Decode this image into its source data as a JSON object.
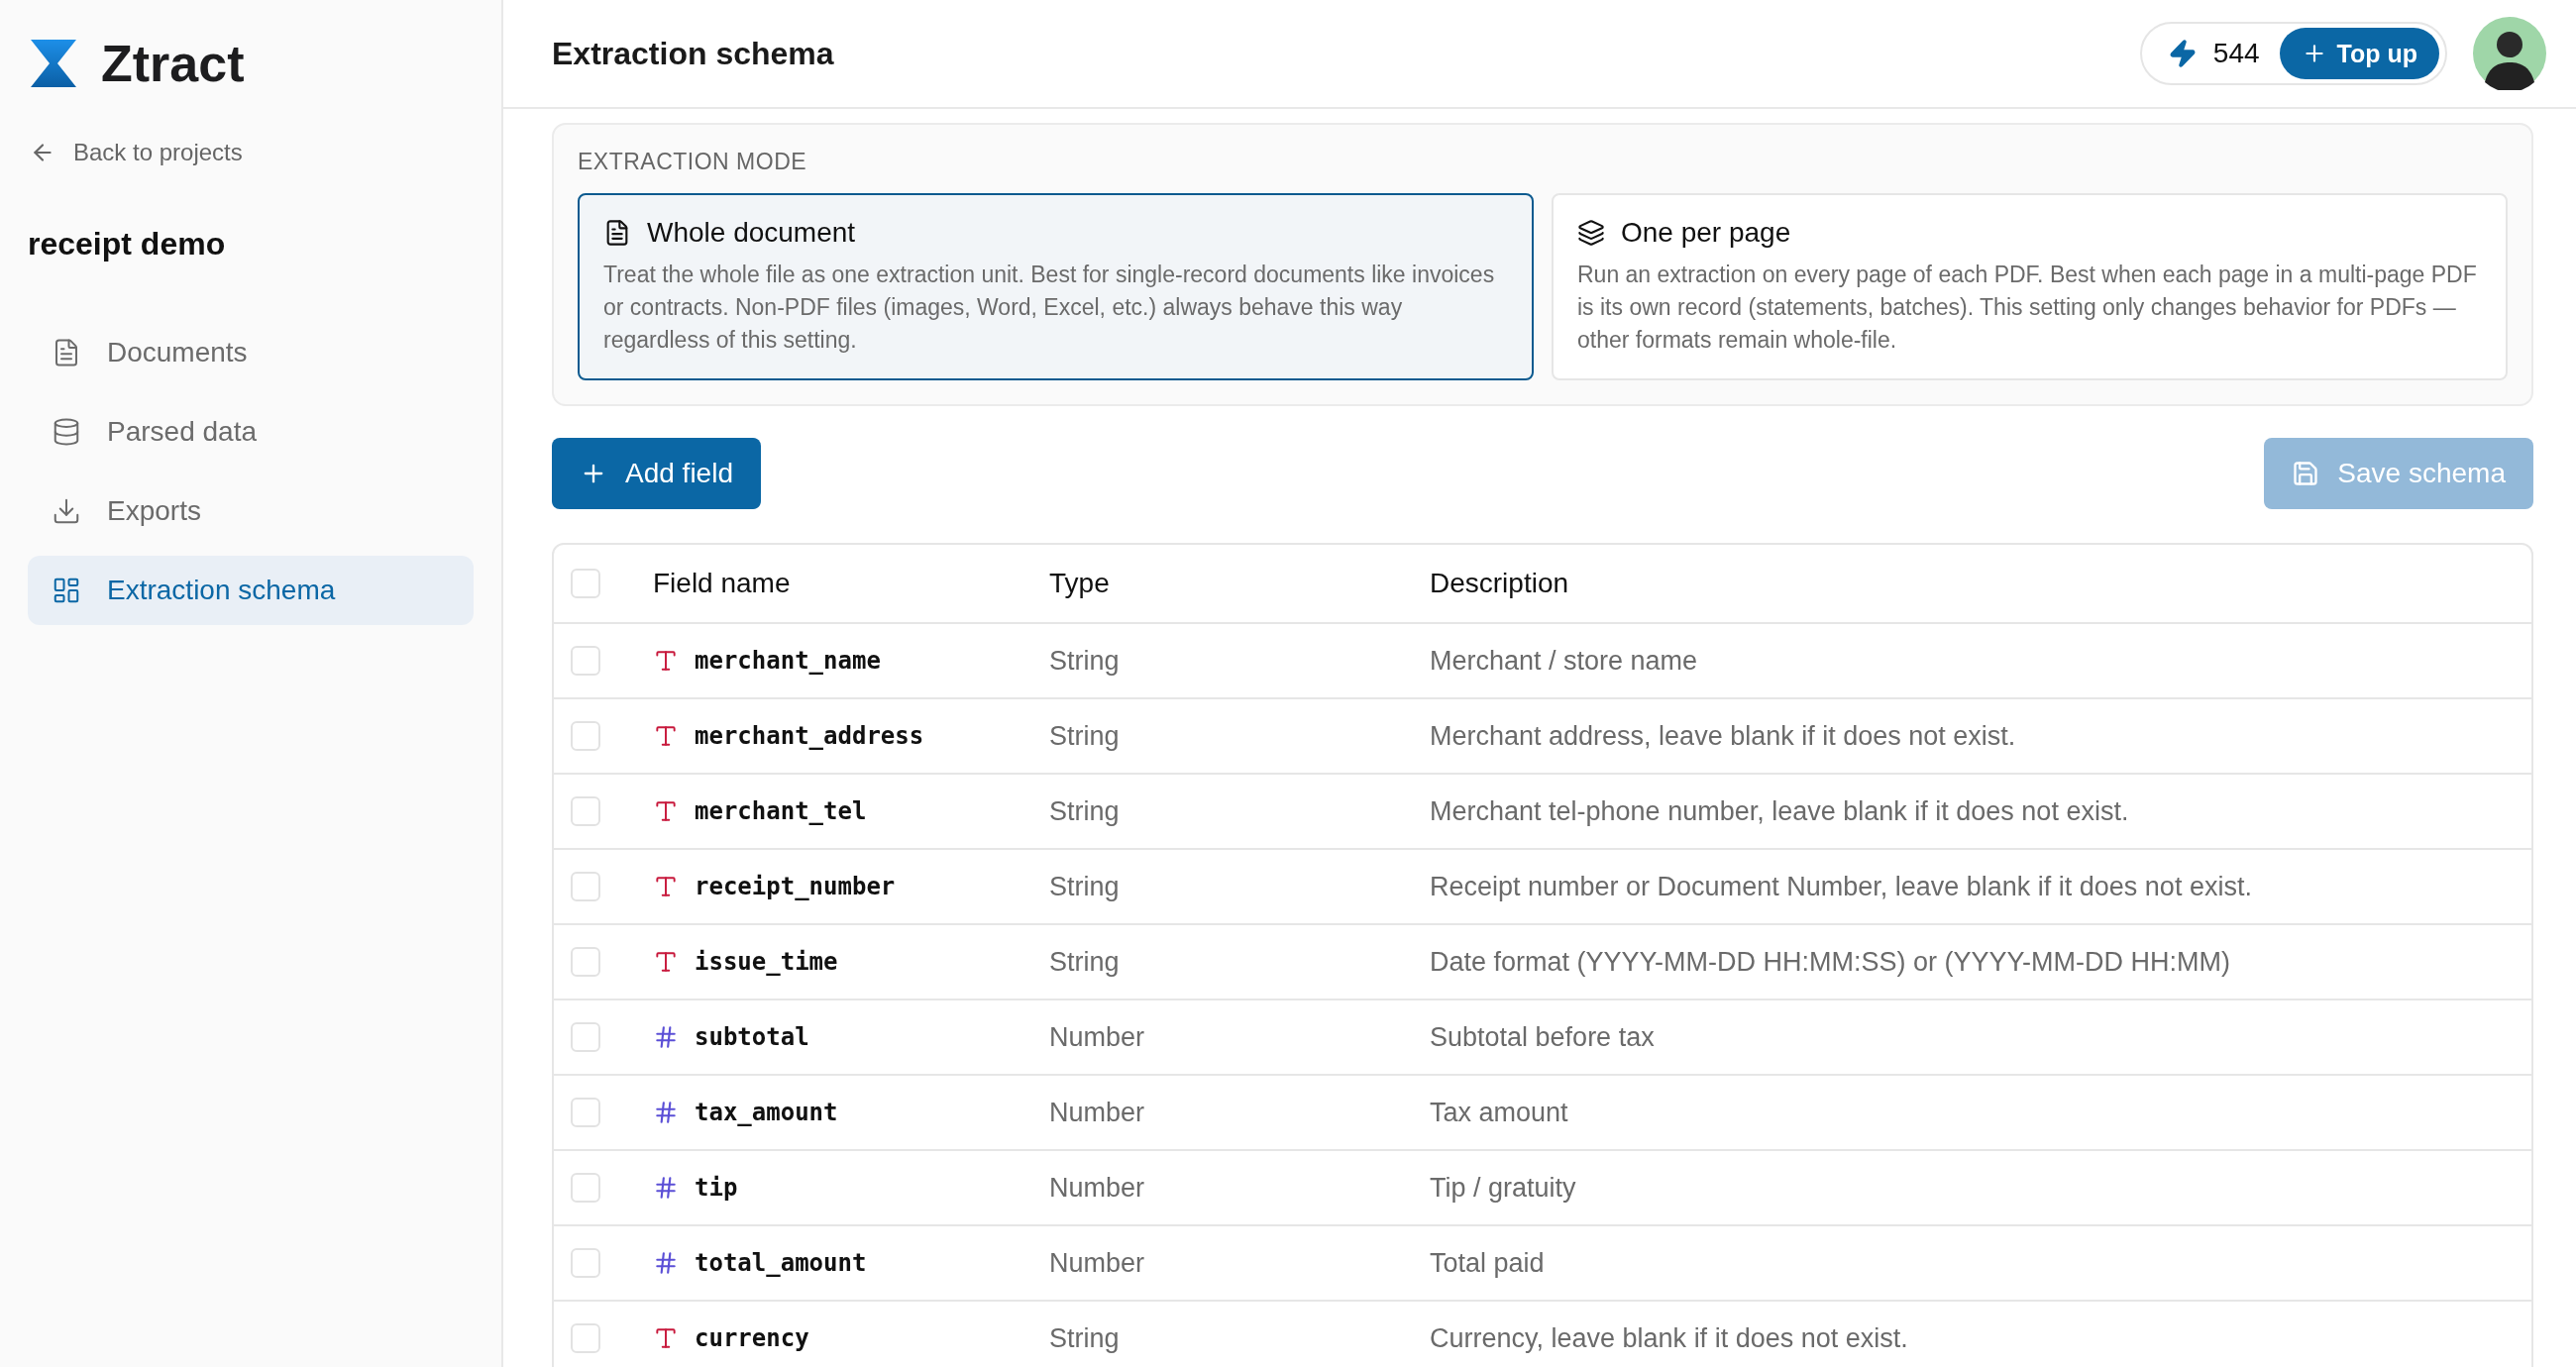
{
  "brand": {
    "name": "Ztract"
  },
  "sidebar": {
    "back_link": "Back to projects",
    "project": "receipt demo",
    "items": [
      {
        "label": "Documents",
        "kind": "documents",
        "selected": false
      },
      {
        "label": "Parsed data",
        "kind": "database",
        "selected": false
      },
      {
        "label": "Exports",
        "kind": "download",
        "selected": false
      },
      {
        "label": "Extraction schema",
        "kind": "schema",
        "selected": true
      }
    ]
  },
  "header": {
    "title": "Extraction schema",
    "credits": "544",
    "top_up": "Top up"
  },
  "extraction_mode": {
    "label": "EXTRACTION MODE",
    "options": [
      {
        "kind": "document",
        "title": "Whole document",
        "description": "Treat the whole file as one extraction unit. Best for single-record documents like invoices or contracts. Non-PDF files (images, Word, Excel, etc.) always behave this way regardless of this setting.",
        "selected": true
      },
      {
        "kind": "layers",
        "title": "One per page",
        "description": "Run an extraction on every page of each PDF. Best when each page in a multi-page PDF is its own record (statements, batches). This setting only changes behavior for PDFs — other formats remain whole-file.",
        "selected": false
      }
    ]
  },
  "actions": {
    "add_field": "Add field",
    "save_schema": {
      "label": "Save schema",
      "disabled": true
    }
  },
  "table": {
    "columns": [
      "Field name",
      "Type",
      "Description"
    ],
    "all_checked": false,
    "rows": [
      {
        "checked": false,
        "kind": "string",
        "name": "merchant_name",
        "type": "String",
        "description": "Merchant / store name"
      },
      {
        "checked": false,
        "kind": "string",
        "name": "merchant_address",
        "type": "String",
        "description": "Merchant address, leave blank if it does not exist."
      },
      {
        "checked": false,
        "kind": "string",
        "name": "merchant_tel",
        "type": "String",
        "description": "Merchant tel-phone number, leave blank if it does not exist."
      },
      {
        "checked": false,
        "kind": "string",
        "name": "receipt_number",
        "type": "String",
        "description": "Receipt number or Document Number, leave blank if it does not exist."
      },
      {
        "checked": false,
        "kind": "string",
        "name": "issue_time",
        "type": "String",
        "description": "Date format (YYYY-MM-DD HH:MM:SS) or (YYYY-MM-DD HH:MM)"
      },
      {
        "checked": false,
        "kind": "number",
        "name": "subtotal",
        "type": "Number",
        "description": "Subtotal before tax"
      },
      {
        "checked": false,
        "kind": "number",
        "name": "tax_amount",
        "type": "Number",
        "description": "Tax amount"
      },
      {
        "checked": false,
        "kind": "number",
        "name": "tip",
        "type": "Number",
        "description": "Tip / gratuity"
      },
      {
        "checked": false,
        "kind": "number",
        "name": "total_amount",
        "type": "Number",
        "description": "Total paid"
      },
      {
        "checked": false,
        "kind": "string",
        "name": "currency",
        "type": "String",
        "description": "Currency, leave blank if it does not exist."
      }
    ]
  }
}
